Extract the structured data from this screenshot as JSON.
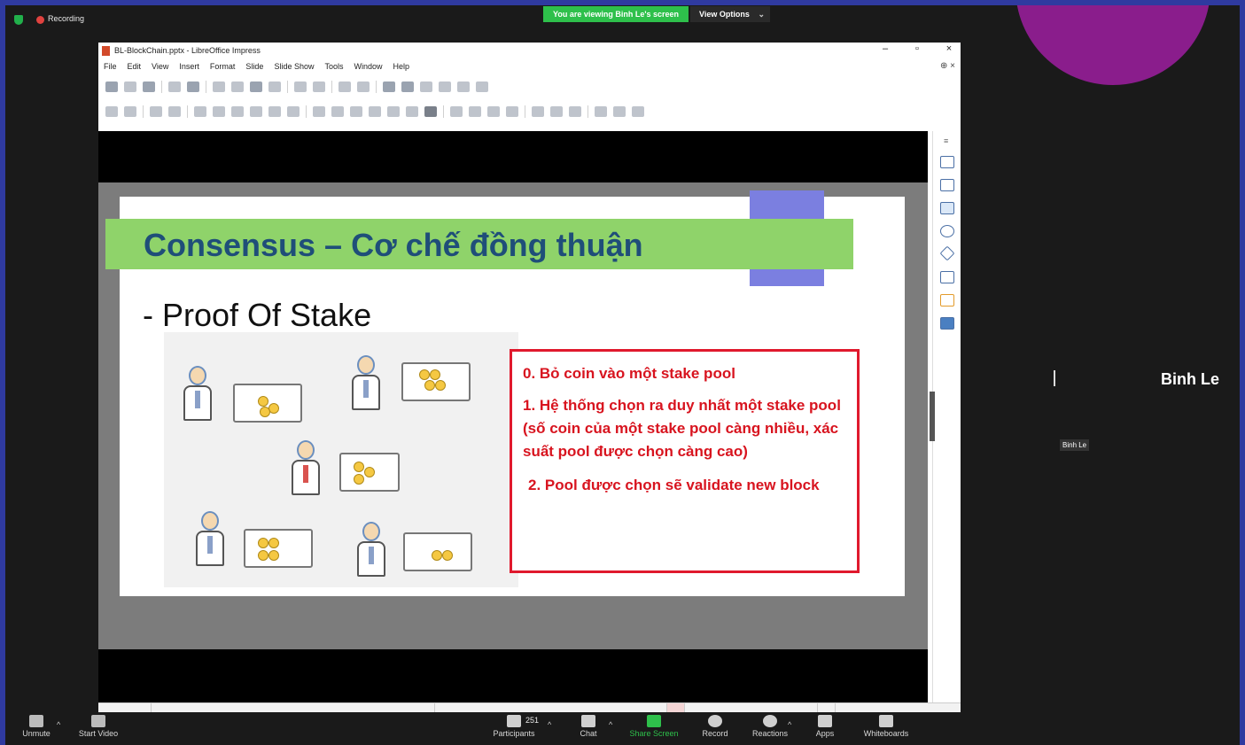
{
  "zoom_bar": {
    "recording_label": "Recording",
    "viewing_label": "You are viewing Binh Le's screen",
    "view_options_label": "View Options"
  },
  "libreoffice": {
    "window_title": "BL-BlockChain.pptx - LibreOffice Impress",
    "menu": [
      "File",
      "Edit",
      "View",
      "Insert",
      "Format",
      "Slide",
      "Slide Show",
      "Tools",
      "Window",
      "Help"
    ]
  },
  "slide": {
    "title": "Consensus – Cơ chế đồng thuận",
    "bullet": "- Proof Of Stake",
    "steps": [
      "0. Bỏ coin vào một stake pool",
      "1. Hệ thống chọn ra duy nhất một stake pool (số coin của một stake pool càng nhiều, xác suất pool được chọn càng cao)",
      "2. Pool được chọn sẽ validate new block"
    ],
    "colors": {
      "title_band": "#8fd36a",
      "title_text": "#1f4e79",
      "accent_square": "#7b7fe0",
      "box_border": "#e0192d",
      "box_text": "#d8141f"
    }
  },
  "participant": {
    "name_large": "Binh Le",
    "name_tag": "Binh Le"
  },
  "bottom_bar": {
    "participants_count": "251",
    "items": [
      {
        "label": "Unmute",
        "icon": "microphone-muted-icon"
      },
      {
        "label": "Start Video",
        "icon": "video-off-icon"
      },
      {
        "label": "Participants",
        "icon": "participants-icon"
      },
      {
        "label": "Chat",
        "icon": "chat-icon"
      },
      {
        "label": "Share Screen",
        "icon": "share-screen-icon"
      },
      {
        "label": "Record",
        "icon": "record-icon"
      },
      {
        "label": "Reactions",
        "icon": "reactions-icon"
      },
      {
        "label": "Apps",
        "icon": "apps-icon"
      },
      {
        "label": "Whiteboards",
        "icon": "whiteboard-icon"
      }
    ]
  }
}
